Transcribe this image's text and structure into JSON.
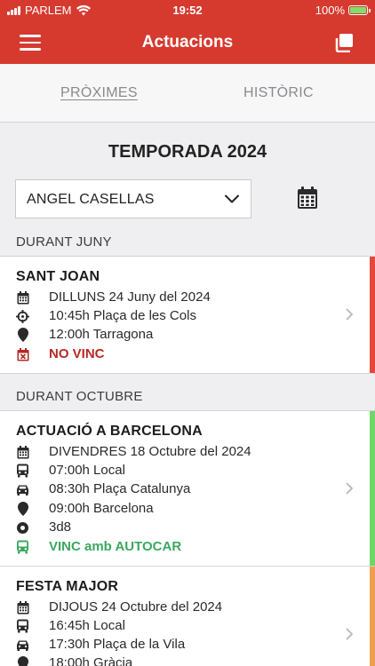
{
  "status_bar": {
    "carrier": "PARLEM",
    "time": "19:52",
    "battery": "100%"
  },
  "app_bar": {
    "title": "Actuacions",
    "menu_icon": "hamburger-icon",
    "action_icon": "copy-icon"
  },
  "tabs": [
    {
      "label": "PRÒXIMES",
      "active": true
    },
    {
      "label": "HISTÒRIC",
      "active": false
    }
  ],
  "season_title": "TEMPORADA 2024",
  "filter": {
    "selected": "ANGEL CASELLAS"
  },
  "colors": {
    "brand": "#d63a2f",
    "red": "#e2493b",
    "green": "#6fd66b",
    "orange": "#f0a04b"
  },
  "sections": [
    {
      "header": "DURANT JUNY",
      "events": [
        {
          "title": "SANT JOAN",
          "status_color": "#e2493b",
          "rows": [
            {
              "icon": "calendar-icon",
              "text": "DILLUNS 24 Juny del 2024"
            },
            {
              "icon": "crosshair-icon",
              "text": "10:45h Plaça de les Cols"
            },
            {
              "icon": "map-pin-icon",
              "text": "12:00h Tarragona"
            },
            {
              "icon": "calendar-x-icon",
              "text": "NO VINC",
              "kind": "status-red"
            }
          ]
        }
      ]
    },
    {
      "header": "DURANT OCTUBRE",
      "events": [
        {
          "title": "ACTUACIÓ A BARCELONA",
          "status_color": "#6fd66b",
          "rows": [
            {
              "icon": "calendar-icon",
              "text": "DIVENDRES 18 Octubre del 2024"
            },
            {
              "icon": "bus-icon",
              "text": "07:00h Local"
            },
            {
              "icon": "car-icon",
              "text": "08:30h Plaça Catalunya"
            },
            {
              "icon": "map-pin-icon",
              "text": "09:00h Barcelona"
            },
            {
              "icon": "target-icon",
              "text": "3d8"
            },
            {
              "icon": "bus-icon",
              "text": "VINC amb AUTOCAR",
              "kind": "status-green"
            }
          ]
        },
        {
          "title": "FESTA MAJOR",
          "status_color": "#f0a04b",
          "rows": [
            {
              "icon": "calendar-icon",
              "text": "DIJOUS 24 Octubre del 2024"
            },
            {
              "icon": "bus-icon",
              "text": "16:45h Local"
            },
            {
              "icon": "car-icon",
              "text": "17:30h Plaça de la Vila"
            },
            {
              "icon": "map-pin-icon",
              "text": "18:00h Gràcia"
            }
          ]
        }
      ]
    }
  ]
}
